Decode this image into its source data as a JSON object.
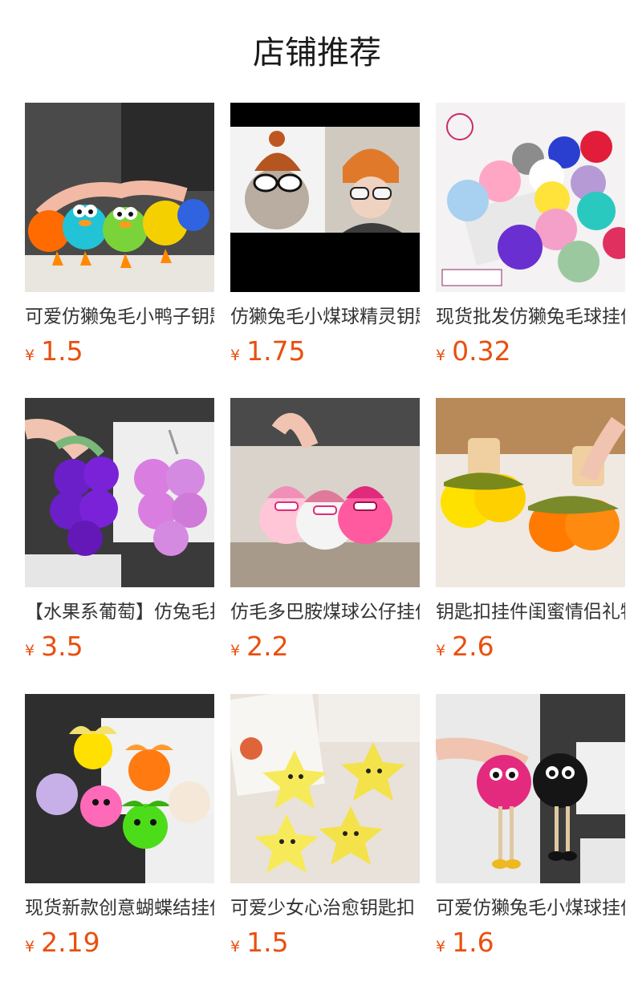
{
  "section": {
    "title": "店铺推荐"
  },
  "products": [
    {
      "name": "可爱仿獭兔毛小鸭子钥匙扣",
      "price": "1.5",
      "currency": "¥",
      "image": "duck-plush-keychains"
    },
    {
      "name": "仿獭兔毛小煤球精灵钥匙扣",
      "price": "1.75",
      "currency": "¥",
      "image": "soot-sprite-with-hat"
    },
    {
      "name": "现货批发仿獭兔毛球挂件",
      "price": "0.32",
      "currency": "¥",
      "image": "colorful-fur-balls"
    },
    {
      "name": "【水果系葡萄】仿兔毛挂件",
      "price": "3.5",
      "currency": "¥",
      "image": "grape-fur-keychains"
    },
    {
      "name": "仿毛多巴胺煤球公仔挂件",
      "price": "2.2",
      "currency": "¥",
      "image": "pink-beanie-puffballs"
    },
    {
      "name": "钥匙扣挂件闺蜜情侣礼物",
      "price": "2.6",
      "currency": "¥",
      "image": "persimmon-fur-keychains"
    },
    {
      "name": "现货新款创意蝴蝶结挂件",
      "price": "2.19",
      "currency": "¥",
      "image": "bow-fluffy-monsters"
    },
    {
      "name": "可爱少女心治愈钥匙扣",
      "price": "1.5",
      "currency": "¥",
      "image": "yellow-star-keychains"
    },
    {
      "name": "可爱仿獭兔毛小煤球挂件",
      "price": "1.6",
      "currency": "¥",
      "image": "pink-black-soot-sprites"
    }
  ]
}
